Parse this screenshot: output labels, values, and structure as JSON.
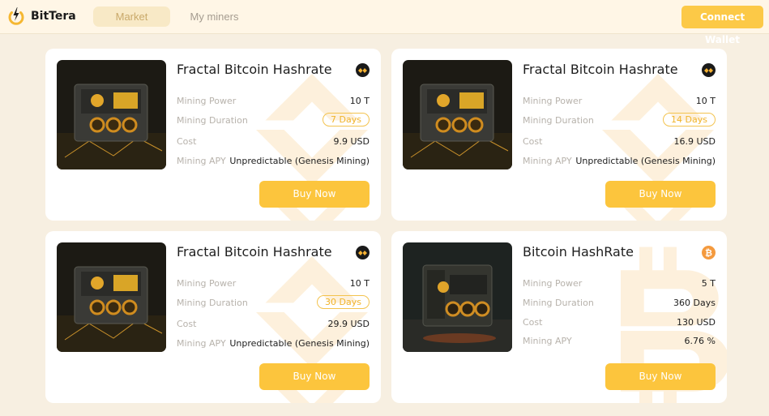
{
  "brand": {
    "name": "BitTera"
  },
  "nav": {
    "market": "Market",
    "my_miners": "My miners"
  },
  "header": {
    "connect_wallet": "Connect Wallet"
  },
  "colors": {
    "accent": "#fcc53d",
    "background": "#f7efe1",
    "fractal_coin": "#1a1a1a",
    "bitcoin_coin": "#f49a3e"
  },
  "cards": [
    {
      "title": "Fractal Bitcoin Hashrate",
      "coin_icon": "fractal-coin-icon",
      "mining_power_label": "Mining Power",
      "mining_power": "10 T",
      "duration_label": "Mining Duration",
      "duration": "7 Days",
      "cost_label": "Cost",
      "cost": "9.9 USD",
      "apy_label": "Mining APY",
      "apy": "Unpredictable (Genesis Mining)",
      "buy_label": "Buy Now"
    },
    {
      "title": "Fractal Bitcoin Hashrate",
      "coin_icon": "fractal-coin-icon",
      "mining_power_label": "Mining Power",
      "mining_power": "10 T",
      "duration_label": "Mining Duration",
      "duration": "14 Days",
      "cost_label": "Cost",
      "cost": "16.9 USD",
      "apy_label": "Mining APY",
      "apy": "Unpredictable (Genesis Mining)",
      "buy_label": "Buy Now"
    },
    {
      "title": "Fractal Bitcoin Hashrate",
      "coin_icon": "fractal-coin-icon",
      "mining_power_label": "Mining Power",
      "mining_power": "10 T",
      "duration_label": "Mining Duration",
      "duration": "30 Days",
      "cost_label": "Cost",
      "cost": "29.9 USD",
      "apy_label": "Mining APY",
      "apy": "Unpredictable (Genesis Mining)",
      "buy_label": "Buy Now"
    },
    {
      "title": "Bitcoin HashRate",
      "coin_icon": "bitcoin-icon",
      "mining_power_label": "Mining Power",
      "mining_power": "5 T",
      "duration_label": "Mining Duration",
      "duration": "360 Days",
      "cost_label": "Cost",
      "cost": "130 USD",
      "apy_label": "Mining APY",
      "apy": "6.76 %",
      "buy_label": "Buy Now"
    }
  ]
}
